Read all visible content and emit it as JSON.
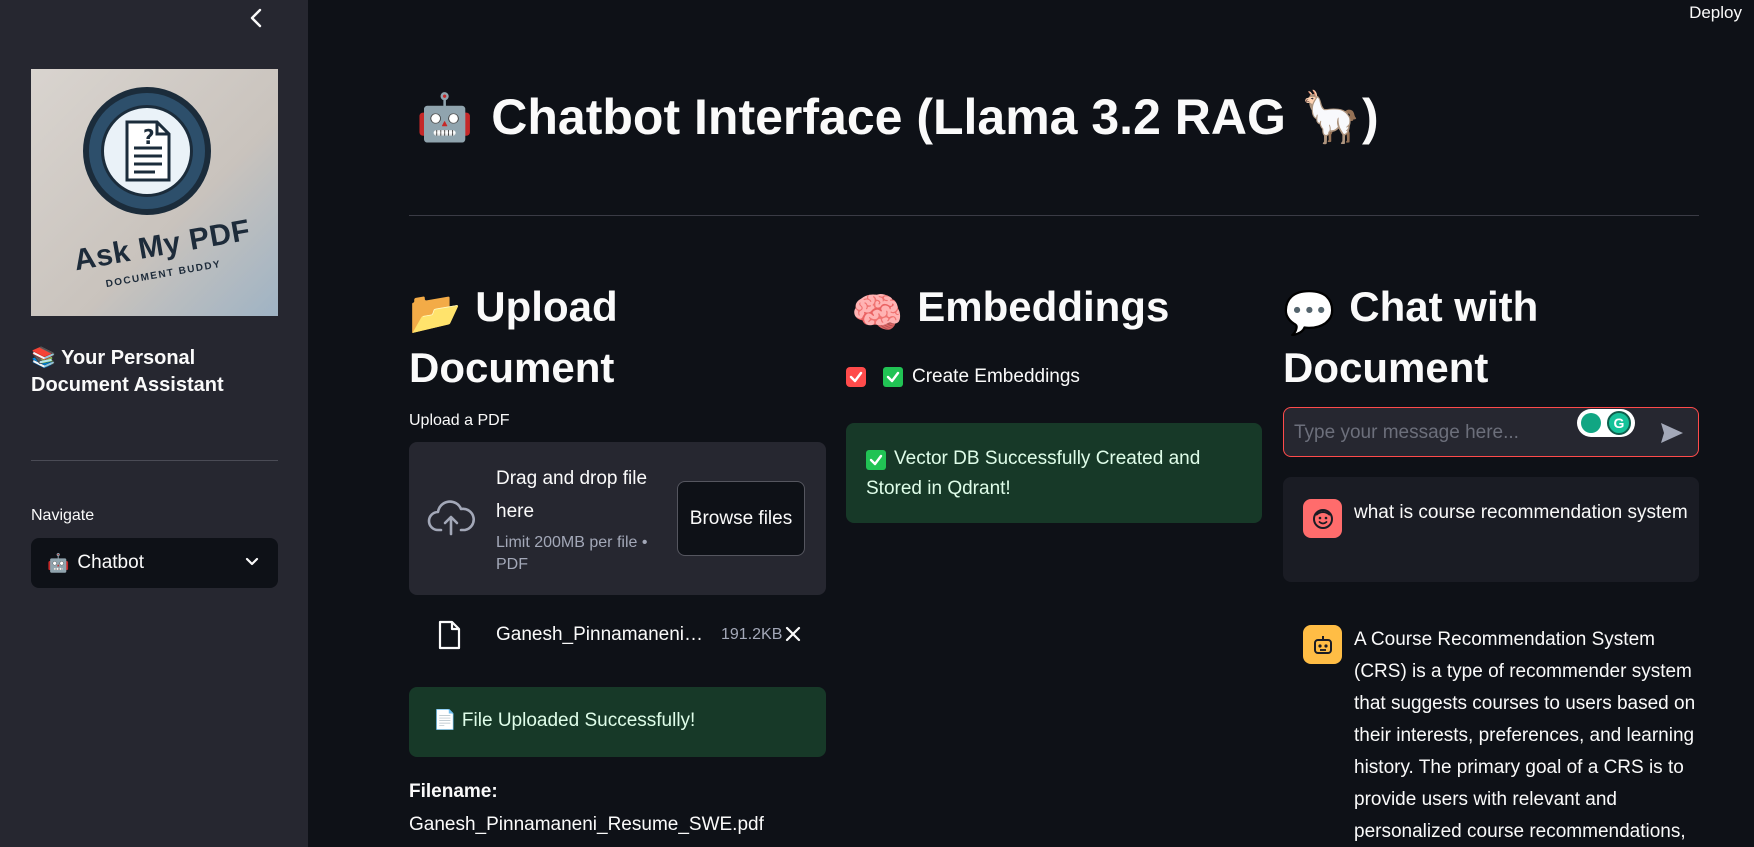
{
  "header": {
    "deploy_label": "Deploy"
  },
  "sidebar": {
    "logo": {
      "title": "Ask My PDF",
      "subtitle": "DOCUMENT BUDDY"
    },
    "assistant_title": "📚 Your Personal Document Assistant",
    "nav_label": "Navigate",
    "nav_selected": "Chatbot"
  },
  "main": {
    "title_icon": "🤖",
    "title": "Chatbot Interface (Llama 3.2 RAG 🦙)"
  },
  "upload": {
    "heading_icon": "📂",
    "heading": "Upload Document",
    "label": "Upload a PDF",
    "dropzone_text": "Drag and drop file here",
    "dropzone_limit": "Limit 200MB per file • PDF",
    "browse_label": "Browse files",
    "file_name": "Ganesh_Pinnamaneni_Resume_SWE.pdf",
    "file_size": "191.2KB",
    "success_message": "📄 File Uploaded Successfully!",
    "filename_label": "Filename:",
    "filename_value": "Ganesh_Pinnamaneni_Resume_SWE.pdf"
  },
  "embeddings": {
    "heading_icon": "🧠",
    "heading": "Embeddings",
    "checkbox_label": "Create Embeddings",
    "checkbox_checked": true,
    "success_message": "Vector DB Successfully Created and Stored in Qdrant!"
  },
  "chat": {
    "heading_icon": "💬",
    "heading": "Chat with Document",
    "input_placeholder": "Type your message here...",
    "messages": [
      {
        "role": "user",
        "text": "what is course recommendation system"
      },
      {
        "role": "assistant",
        "text": "A Course Recommendation System (CRS) is a type of recommender system that suggests courses to users based on their interests, preferences, and learning history. The primary goal of a CRS is to provide users with relevant and personalized course recommendations,"
      }
    ]
  },
  "colors": {
    "background": "#0e1117",
    "sidebar": "#262730",
    "accent_red": "#ff4b4b",
    "success_bg": "#173928",
    "success_check": "#21c354"
  }
}
